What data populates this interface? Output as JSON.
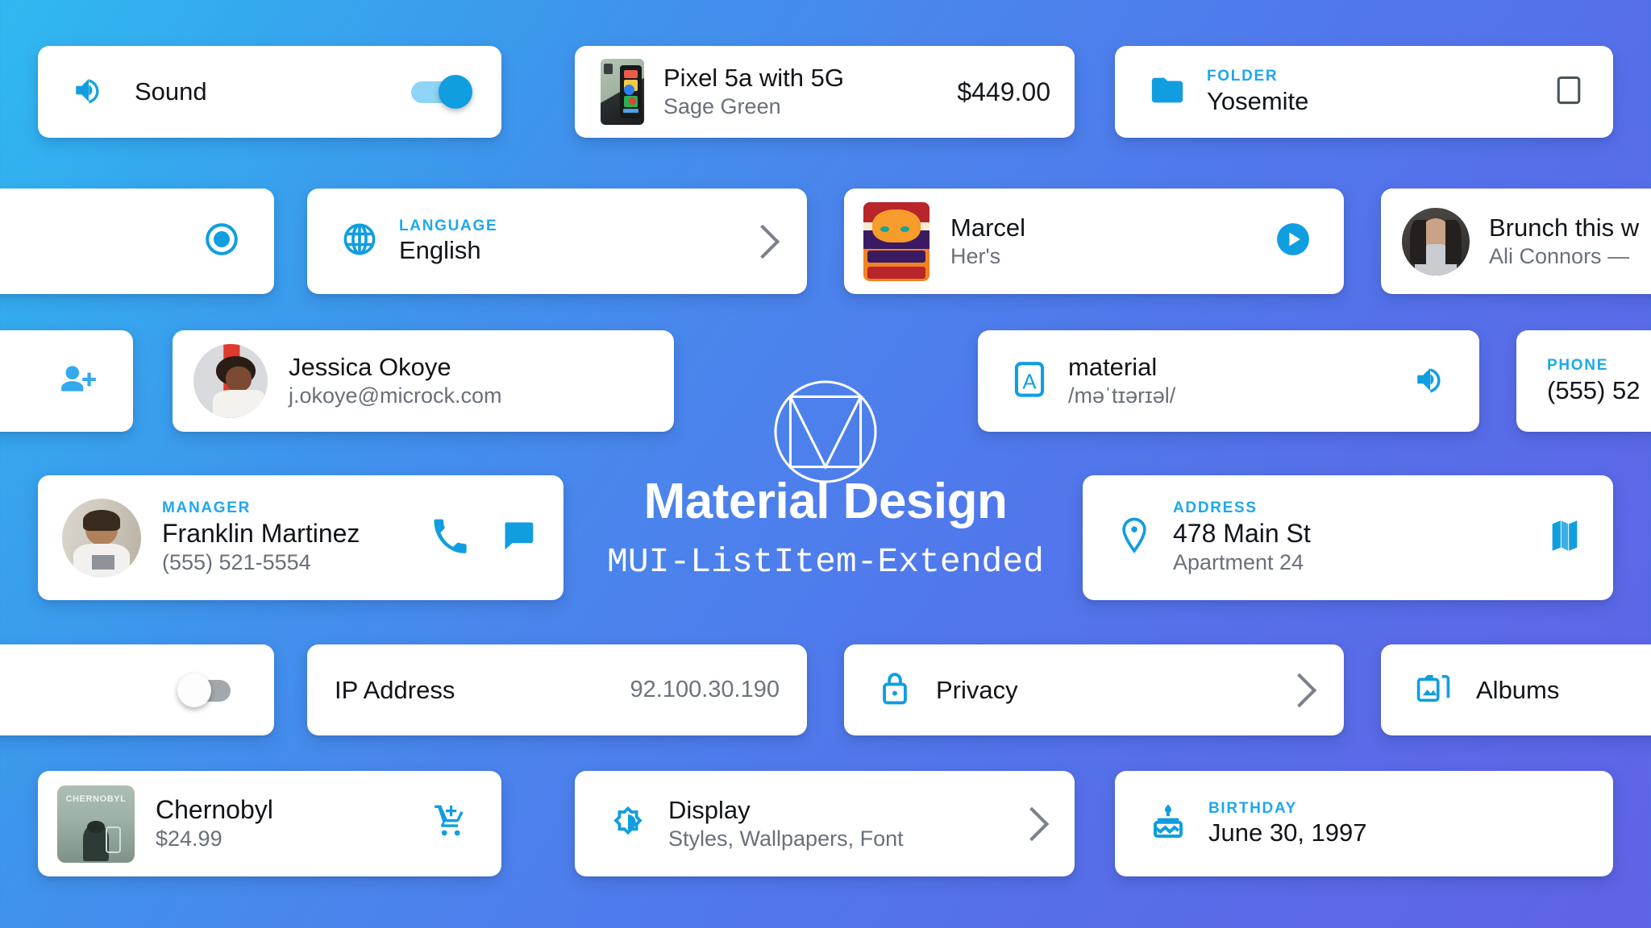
{
  "brand": {
    "title": "Material Design",
    "subtitle": "MUI-ListItem-Extended",
    "logo_icon": "material-design-logo"
  },
  "colors": {
    "accent": "#1ea7ef",
    "accent_strong": "#109ee0",
    "primary_text": "#111418",
    "secondary_text": "#69707a",
    "card_bg": "#ffffff",
    "bg_gradient_start": "#2fb9f0",
    "bg_gradient_end": "#5f63e6"
  },
  "cards": {
    "sound": {
      "icon": "volume-up-icon",
      "label": "Sound",
      "toggle_state": "on"
    },
    "pixel_phone": {
      "thumbnail": "pixel-phone-image",
      "title": "Pixel 5a with 5G",
      "subtitle": "Sage Green",
      "price": "$449.00"
    },
    "folder": {
      "icon": "folder-icon",
      "overline": "FOLDER",
      "value": "Yosemite",
      "checkbox_icon": "checkbox-unchecked-icon"
    },
    "radio": {
      "icon": "radio-button-checked-icon",
      "state": "checked"
    },
    "language": {
      "icon": "globe-icon",
      "overline": "LANGUAGE",
      "value": "English",
      "chevron_icon": "chevron-right-icon"
    },
    "music": {
      "thumbnail": "album-art-marcel",
      "title": "Marcel",
      "subtitle": "Her's",
      "play_icon": "play-circle-icon"
    },
    "message": {
      "avatar": "avatar-ali-connors",
      "title": "Brunch this w",
      "subtitle": "Ali Connors —"
    },
    "add_person": {
      "icon": "person-add-icon"
    },
    "contact": {
      "avatar": "avatar-jessica-okoye",
      "name": "Jessica Okoye",
      "email": "j.okoye@microck.com"
    },
    "dictionary": {
      "icon": "translate-letter-a-icon",
      "word": "material",
      "pronunciation": "/məˈtɪərɪəl/",
      "sound_icon": "volume-up-icon"
    },
    "phone_right": {
      "overline": "PHONE",
      "value": "(555) 52"
    },
    "manager": {
      "avatar": "avatar-franklin-martinez",
      "overline": "MANAGER",
      "name": "Franklin Martinez",
      "phone": "(555) 521-5554",
      "call_icon": "phone-icon",
      "message_icon": "chat-bubble-icon"
    },
    "address": {
      "icon": "location-pin-icon",
      "overline": "ADDRESS",
      "line1": "478 Main St",
      "line2": "Apartment 24",
      "map_icon": "map-icon"
    },
    "toggle_off": {
      "toggle_state": "off"
    },
    "ip_address": {
      "label": "IP Address",
      "value": "92.100.30.190"
    },
    "privacy": {
      "icon": "lock-icon",
      "label": "Privacy",
      "chevron_icon": "chevron-right-icon"
    },
    "albums": {
      "icon": "photo-album-icon",
      "label": "Albums"
    },
    "chernobyl": {
      "thumbnail": "chernobyl-poster",
      "poster_text": "CHERNOBYL",
      "title": "Chernobyl",
      "price": "$24.99",
      "cart_icon": "add-shopping-cart-icon"
    },
    "display": {
      "icon": "brightness-icon",
      "title": "Display",
      "subtitle": "Styles, Wallpapers, Font",
      "chevron_icon": "chevron-right-icon"
    },
    "birthday": {
      "icon": "cake-icon",
      "overline": "BIRTHDAY",
      "value": "June 30, 1997"
    }
  }
}
